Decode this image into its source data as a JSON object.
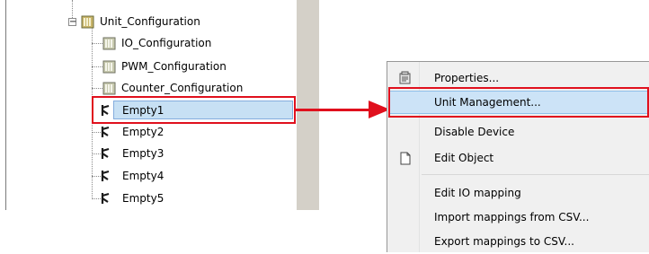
{
  "tree": {
    "root_label": "Unit_Configuration",
    "expander_symbol": "−",
    "children": [
      {
        "label": "IO_Configuration",
        "icon": "unit-icon"
      },
      {
        "label": "PWM_Configuration",
        "icon": "unit-icon"
      },
      {
        "label": "Counter_Configuration",
        "icon": "unit-icon"
      },
      {
        "label": "Empty1",
        "icon": "pin-icon",
        "selected": true
      },
      {
        "label": "Empty2",
        "icon": "pin-icon"
      },
      {
        "label": "Empty3",
        "icon": "pin-icon"
      },
      {
        "label": "Empty4",
        "icon": "pin-icon"
      },
      {
        "label": "Empty5",
        "icon": "pin-icon"
      }
    ]
  },
  "context_menu": {
    "items": [
      {
        "label": "Properties...",
        "icon": "properties-icon"
      },
      {
        "label": "Unit Management...",
        "highlighted": true
      },
      {
        "label": "Disable Device"
      },
      {
        "label": "Edit Object",
        "icon": "edit-object-icon"
      },
      {
        "label": "Edit IO mapping"
      },
      {
        "label": "Import mappings from CSV..."
      },
      {
        "label": "Export mappings to CSV..."
      }
    ]
  },
  "colors": {
    "annotation_red": "#e0101d",
    "selection_blue": "#c7e0f4",
    "menu_background": "#f0f0f0"
  }
}
